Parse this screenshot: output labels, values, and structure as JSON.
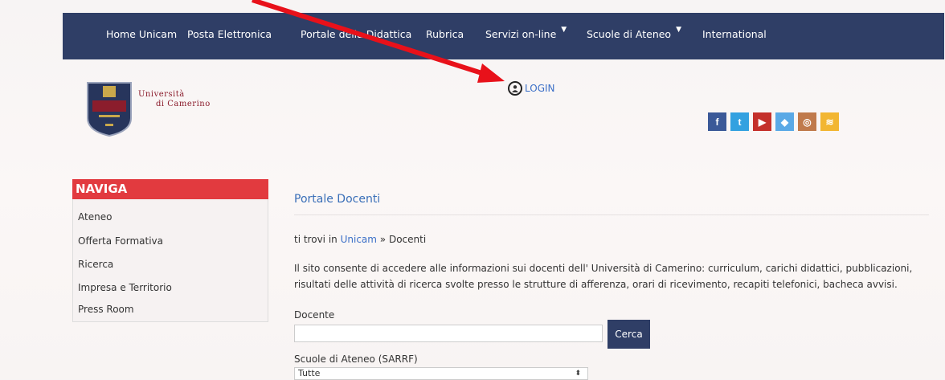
{
  "nav": {
    "items": [
      {
        "label": "Home Unicam"
      },
      {
        "label": "Posta Elettronica"
      },
      {
        "label": "Portale della Didattica"
      },
      {
        "label": "Rubrica"
      },
      {
        "label": "Servizi on-line",
        "dropdown": true
      },
      {
        "label": "Scuole di Ateneo",
        "dropdown": true
      },
      {
        "label": "International"
      }
    ],
    "bg_color": "#2f3e66"
  },
  "logo": {
    "line1": "Università",
    "line2": "di Camerino"
  },
  "login": {
    "label": "LOGIN"
  },
  "social": [
    {
      "icon": "facebook-icon",
      "glyph": "f",
      "color": "#3b5998"
    },
    {
      "icon": "twitter-icon",
      "glyph": "t",
      "color": "#33a1e0"
    },
    {
      "icon": "youtube-icon",
      "glyph": "▶",
      "color": "#c4302b"
    },
    {
      "icon": "dropbox-icon",
      "glyph": "◆",
      "color": "#5aa9e6"
    },
    {
      "icon": "instagram-icon",
      "glyph": "◎",
      "color": "#c07a4c"
    },
    {
      "icon": "rss-icon",
      "glyph": "≋",
      "color": "#f2b632"
    }
  ],
  "sidebar": {
    "title": "NAVIGA",
    "items": [
      "Ateneo",
      "Offerta Formativa",
      "Ricerca",
      "Impresa e Territorio",
      "Press Room"
    ]
  },
  "main": {
    "title": "Portale Docenti",
    "breadcrumb_prefix": "ti trovi in",
    "breadcrumb_link": "Unicam",
    "breadcrumb_current": "» Docenti",
    "description": "Il sito consente di  accedere alle informazioni sui docenti dell' Università di Camerino: curriculum, carichi didattici, pubblicazioni, risultati delle attività di ricerca svolte presso le strutture di afferenza, orari di ricevimento, recapiti telefonici, bacheca avvisi.",
    "docente_label": "Docente",
    "docente_value": "",
    "search_button": "Cerca",
    "scuole_label": "Scuole di Ateneo (SARRF)",
    "scuole_selected": "Tutte"
  },
  "colors": {
    "accent_red": "#e23a3f",
    "link_blue": "#3b6fc7",
    "annotation_arrow": "#e8111a"
  }
}
